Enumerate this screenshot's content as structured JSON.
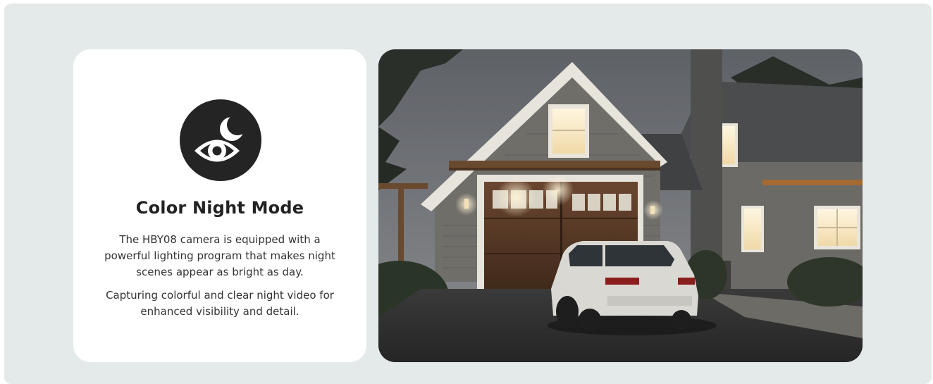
{
  "feature_card": {
    "icon": "night-vision-eye-moon-icon",
    "title": "Color Night Mode",
    "paragraph_1": "The HBY08 camera is equipped with a powerful lighting program that makes night scenes appear as bright as day.",
    "paragraph_2": "Capturing colorful and clear night video for enhanced visibility and detail."
  },
  "photo": {
    "subject": "house-with-garage-and-suv-at-night",
    "icon": "house-night-photo"
  },
  "colors": {
    "page_background": "#e4e9e9",
    "card_background": "#ffffff",
    "icon_circle": "#242424",
    "title_text": "#222222",
    "body_text": "#333333"
  }
}
